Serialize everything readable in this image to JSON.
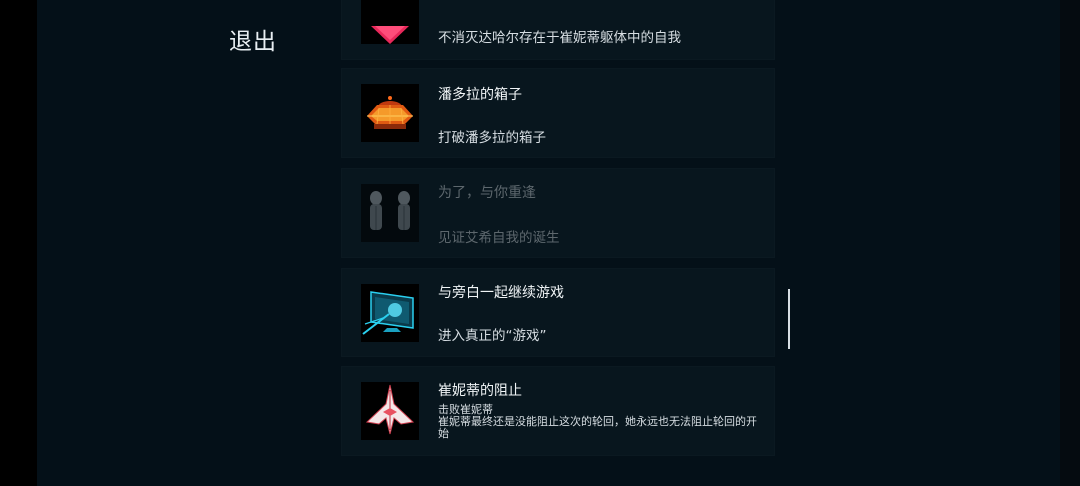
{
  "menu": {
    "exit_label": "退出"
  },
  "achievements": [
    {
      "title": "",
      "description": "不消灭达哈尔存在于崔妮蒂躯体中的自我",
      "icon": "pink-heart-icon",
      "locked": false
    },
    {
      "title": "潘多拉的箱子",
      "description": "打破潘多拉的箱子",
      "icon": "pandora-box-icon",
      "locked": false
    },
    {
      "title": "为了，与你重逢",
      "description": "见证艾希自我的诞生",
      "icon": "twin-figures-icon",
      "locked": true
    },
    {
      "title": "与旁白一起继续游戏",
      "description": "进入真正的“游戏”",
      "icon": "monitor-icon",
      "locked": false
    },
    {
      "title": "崔妮蒂的阻止",
      "description_line1": "击败崔妮蒂",
      "description_line2": "崔妮蒂最终还是没能阻止这次的轮回，她永远也无法阻止轮回的开始",
      "icon": "spaceship-icon",
      "locked": false
    }
  ],
  "colors": {
    "background": "#041018",
    "card": "#08161e",
    "accent_pink": "#e8285a",
    "accent_orange": "#f07a1a",
    "accent_cyan": "#2ad0f0"
  }
}
